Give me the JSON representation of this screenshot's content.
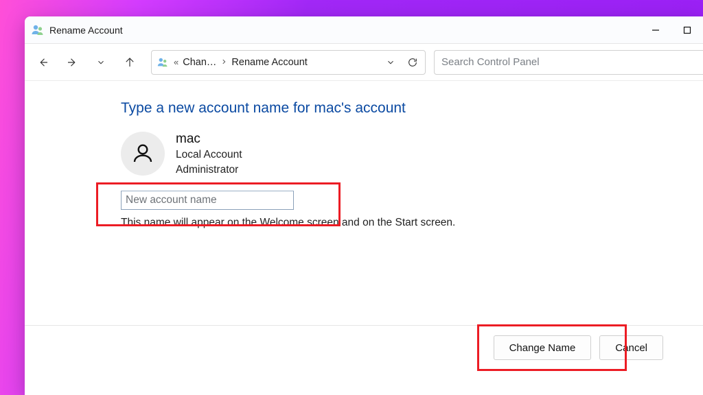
{
  "window": {
    "title": "Rename Account"
  },
  "toolbar": {
    "breadcrumb": {
      "root_sep": "«",
      "crumb1": "Chan…",
      "crumb2": "Rename Account"
    },
    "search_placeholder": "Search Control Panel"
  },
  "page": {
    "heading": "Type a new account name for mac's account",
    "account": {
      "name": "mac",
      "type": "Local Account",
      "role": "Administrator"
    },
    "input_placeholder": "New account name",
    "input_value": "",
    "hint": "This name will appear on the Welcome screen and on the Start screen."
  },
  "buttons": {
    "change": "Change Name",
    "cancel": "Cancel"
  }
}
